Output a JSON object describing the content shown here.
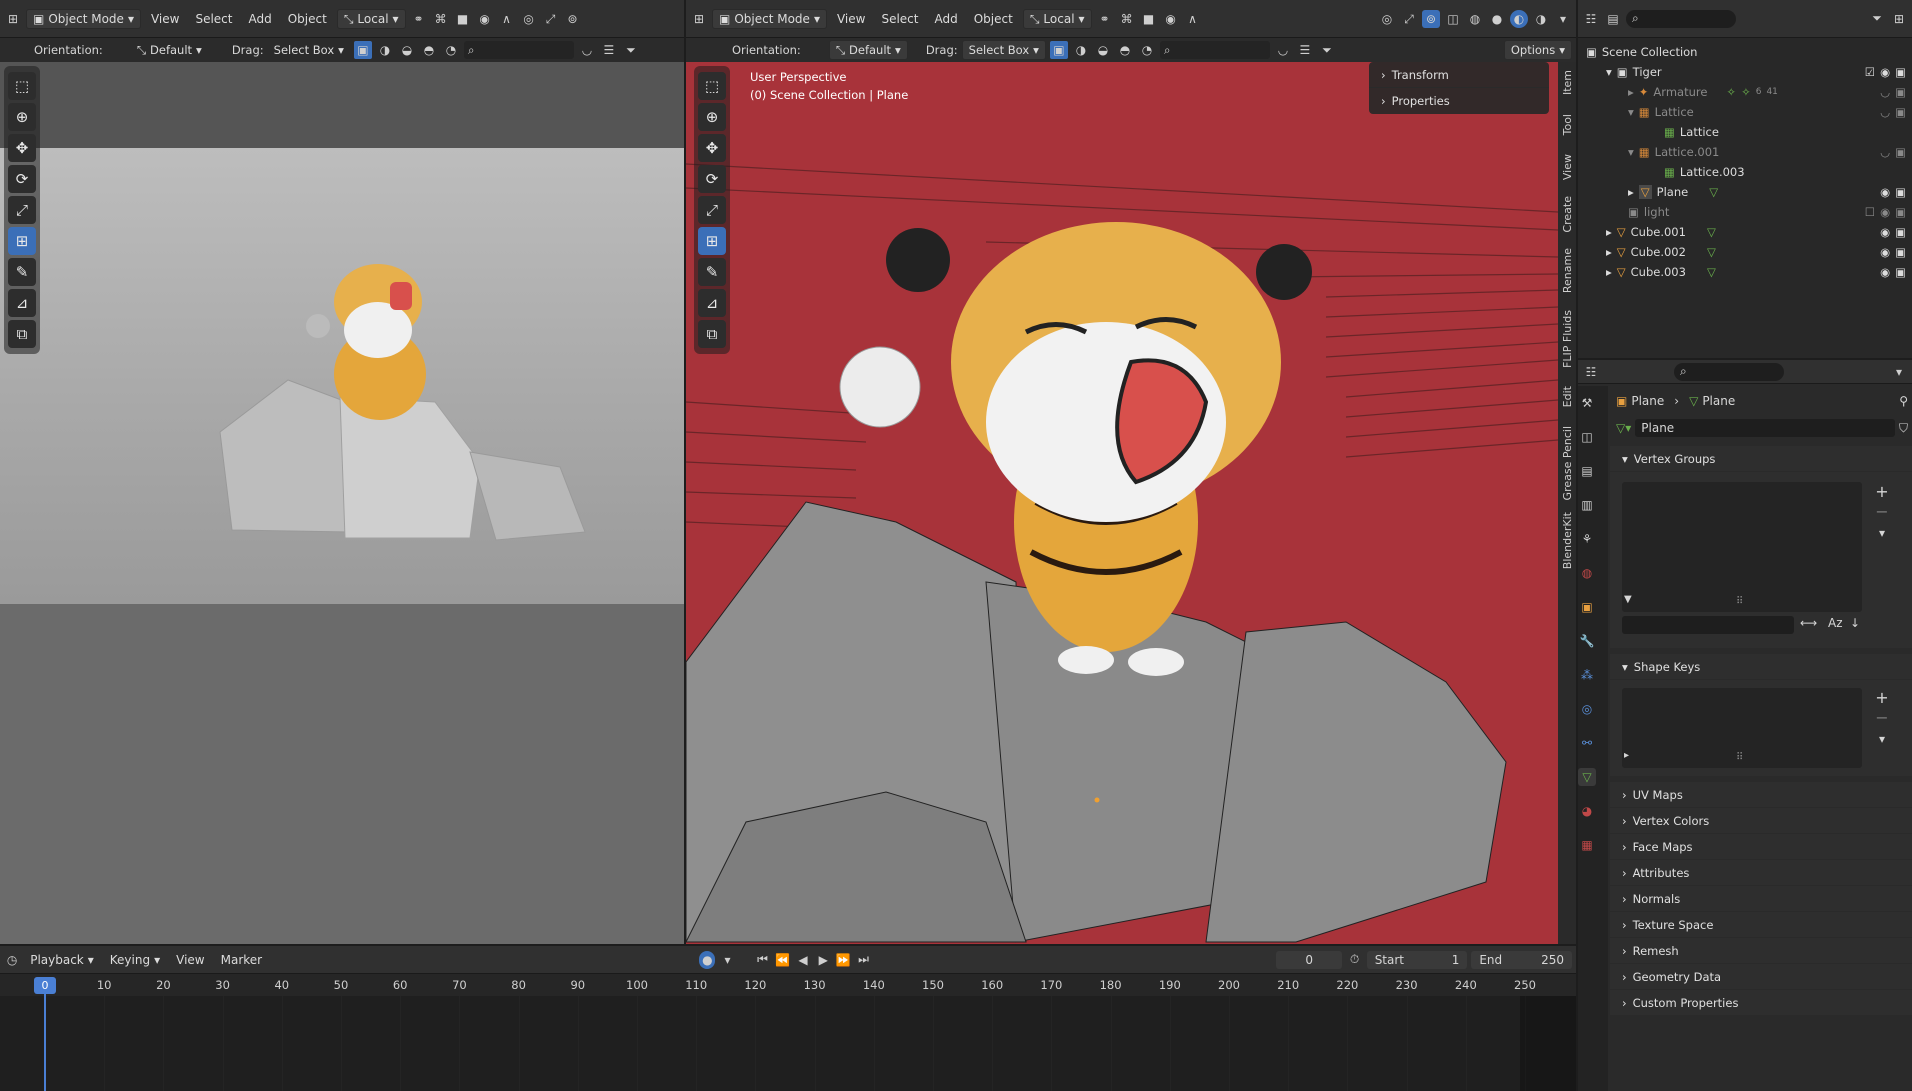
{
  "left_header": {
    "mode": "Object Mode",
    "menus": [
      "View",
      "Select",
      "Add",
      "Object"
    ],
    "pivot": "Local"
  },
  "left_subheader": {
    "orientation_label": "Orientation:",
    "orientation_value": "Default",
    "drag_label": "Drag:",
    "drag_value": "Select Box"
  },
  "right_header": {
    "mode": "Object Mode",
    "menus": [
      "View",
      "Select",
      "Add",
      "Object"
    ],
    "pivot": "Local"
  },
  "right_subheader": {
    "orientation_label": "Orientation:",
    "orientation_value": "Default",
    "drag_label": "Drag:",
    "drag_value": "Select Box",
    "options": "Options"
  },
  "viewport": {
    "perspective": "User Perspective",
    "collection": "(0) Scene Collection | Plane",
    "npanel": [
      "Transform",
      "Properties"
    ],
    "side_tabs": [
      "Item",
      "Tool",
      "View",
      "Create",
      "Rename",
      "FLIP Fluids",
      "Edit",
      "Grease Pencil",
      "BlenderKit"
    ]
  },
  "outliner": {
    "root": "Scene Collection",
    "items": [
      {
        "label": "Tiger",
        "depth": 0
      },
      {
        "label": "Armature",
        "depth": 1,
        "badge": "6",
        "badge2": "41"
      },
      {
        "label": "Lattice",
        "depth": 1
      },
      {
        "label": "Lattice",
        "depth": 2
      },
      {
        "label": "Lattice.001",
        "depth": 1
      },
      {
        "label": "Lattice.003",
        "depth": 2
      },
      {
        "label": "Plane",
        "depth": 1
      },
      {
        "label": "light",
        "depth": 0
      },
      {
        "label": "Cube.001",
        "depth": 0
      },
      {
        "label": "Cube.002",
        "depth": 0
      },
      {
        "label": "Cube.003",
        "depth": 0
      }
    ]
  },
  "properties": {
    "breadcrumb_object": "Plane",
    "breadcrumb_data": "Plane",
    "datablock": "Plane",
    "vertex_groups": "Vertex Groups",
    "shape_keys": "Shape Keys",
    "sections": [
      "UV Maps",
      "Vertex Colors",
      "Face Maps",
      "Attributes",
      "Normals",
      "Texture Space",
      "Remesh",
      "Geometry Data",
      "Custom Properties"
    ]
  },
  "timeline": {
    "menus": [
      "Playback",
      "Keying",
      "View",
      "Marker"
    ],
    "current_frame": "0",
    "start_label": "Start",
    "start_value": "1",
    "end_label": "End",
    "end_value": "250",
    "ticks": [
      "0",
      "10",
      "20",
      "30",
      "40",
      "50",
      "60",
      "70",
      "80",
      "90",
      "100",
      "110",
      "120",
      "130",
      "140",
      "150",
      "160",
      "170",
      "180",
      "190",
      "200",
      "210",
      "220",
      "230",
      "240",
      "250"
    ]
  },
  "colors": {
    "accent": "#3b6fb8",
    "viewport_red": "#a8333a",
    "rock_gray": "#8c8c8c",
    "tiger_orange": "#e4a63b"
  }
}
